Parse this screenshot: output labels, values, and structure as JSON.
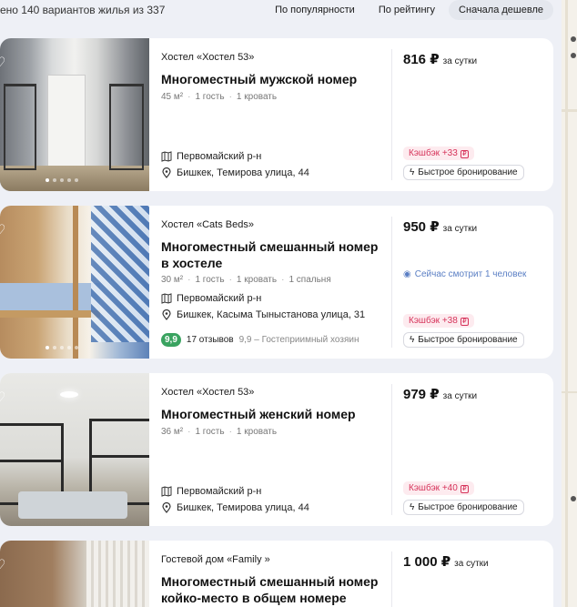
{
  "header": {
    "found_text": "ено 140 вариантов жилья из 337",
    "sort_options": [
      {
        "label": "По популярности",
        "active": false
      },
      {
        "label": "По рейтингу",
        "active": false
      },
      {
        "label": "Сначала дешевле",
        "active": true
      }
    ]
  },
  "listings": [
    {
      "type": "Хостел «Хостел 53»",
      "title": "Многоместный мужской номер",
      "meta": [
        "45 м²",
        "1 гость",
        "1 кровать"
      ],
      "district": "Первомайский р-н",
      "address": "Бишкек, Темирова улица, 44",
      "price": "816 ₽",
      "per": "за сутки",
      "cashback": "Кэшбэк +33",
      "quick_booking": "Быстрое бронирование"
    },
    {
      "type": "Хостел «Cats Beds»",
      "title": "Многоместный смешанный номер в хостеле",
      "meta": [
        "30 м²",
        "1 гость",
        "1 кровать",
        "1 спальня"
      ],
      "district": "Первомайский р-н",
      "address": "Бишкек, Касыма Тыныстанова улица, 31",
      "score": "9,9",
      "reviews": "17 отзывов",
      "review_text": "9,9 – Гостеприимный хозяин",
      "price": "950 ₽",
      "per": "за сутки",
      "viewing": "Сейчас смотрит 1 человек",
      "cashback": "Кэшбэк +38",
      "quick_booking": "Быстрое бронирование"
    },
    {
      "type": "Хостел «Хостел 53»",
      "title": "Многоместный женский номер",
      "meta": [
        "36 м²",
        "1 гость",
        "1 кровать"
      ],
      "district": "Первомайский р-н",
      "address": "Бишкек, Темирова улица, 44",
      "price": "979 ₽",
      "per": "за сутки",
      "cashback": "Кэшбэк +40",
      "quick_booking": "Быстрое бронирование"
    },
    {
      "type": "Гостевой дом «Family »",
      "title": "Многоместный смешанный номер койко-место в общем номере",
      "price": "1 000 ₽",
      "per": "за сутки"
    }
  ],
  "icons": {
    "favorite": "heart-icon",
    "map": "map-icon",
    "pin": "pin-icon",
    "eye": "eye-icon",
    "lightning": "lightning-icon"
  },
  "colors": {
    "accent_blue": "#5b7fc4",
    "cashback_red": "#d6335a",
    "score_green": "#3aa360"
  }
}
